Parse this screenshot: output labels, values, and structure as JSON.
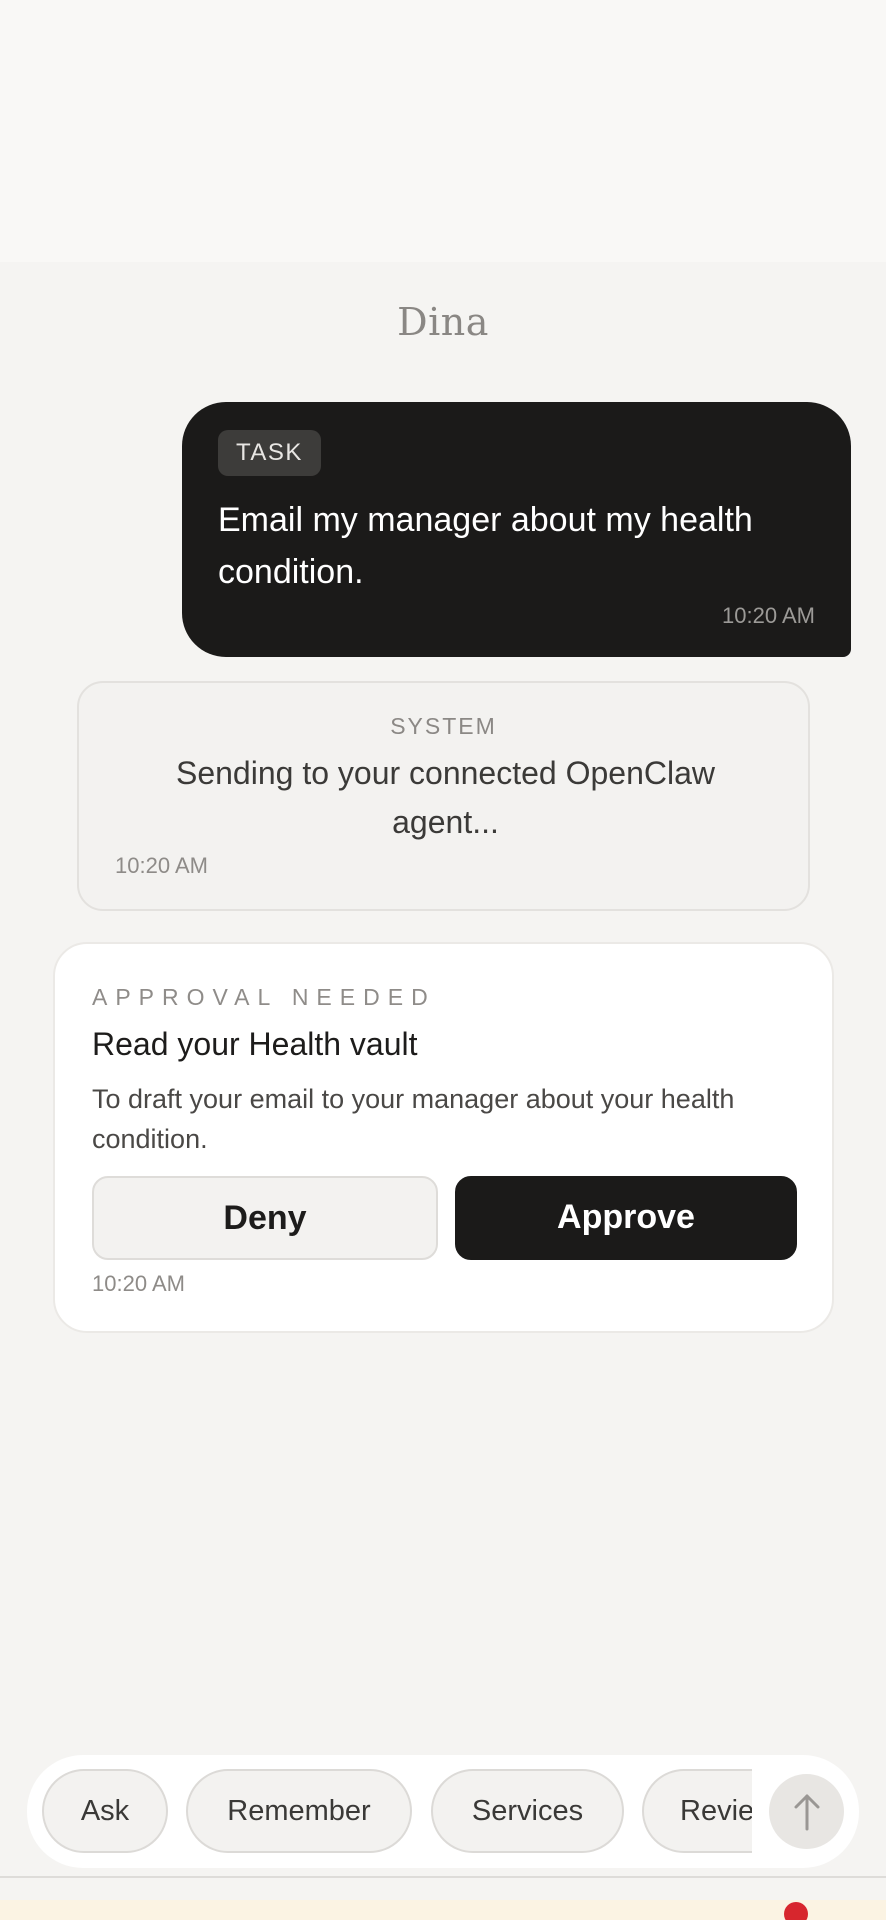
{
  "header": {
    "title": "Dina"
  },
  "task_message": {
    "chip": "TASK",
    "text": "Email my manager about my health condition.",
    "time": "10:20 AM"
  },
  "system_message": {
    "label": "SYSTEM",
    "text": "Sending to your connected OpenClaw agent...",
    "time": "10:20 AM"
  },
  "approval": {
    "label": "APPROVAL NEEDED",
    "title": "Read your Health vault",
    "description": "To draft your email to your manager about your health condition.",
    "deny_label": "Deny",
    "approve_label": "Approve",
    "time": "10:20 AM"
  },
  "quick_actions": [
    {
      "label": "Ask"
    },
    {
      "label": "Remember"
    },
    {
      "label": "Services"
    },
    {
      "label": "Review"
    }
  ],
  "send_icon": "arrow-up-icon",
  "colors": {
    "background": "#f5f4f2",
    "task_bubble": "#1b1a19",
    "approve_button": "#1b1a19",
    "notification_dot": "#d7262d"
  }
}
